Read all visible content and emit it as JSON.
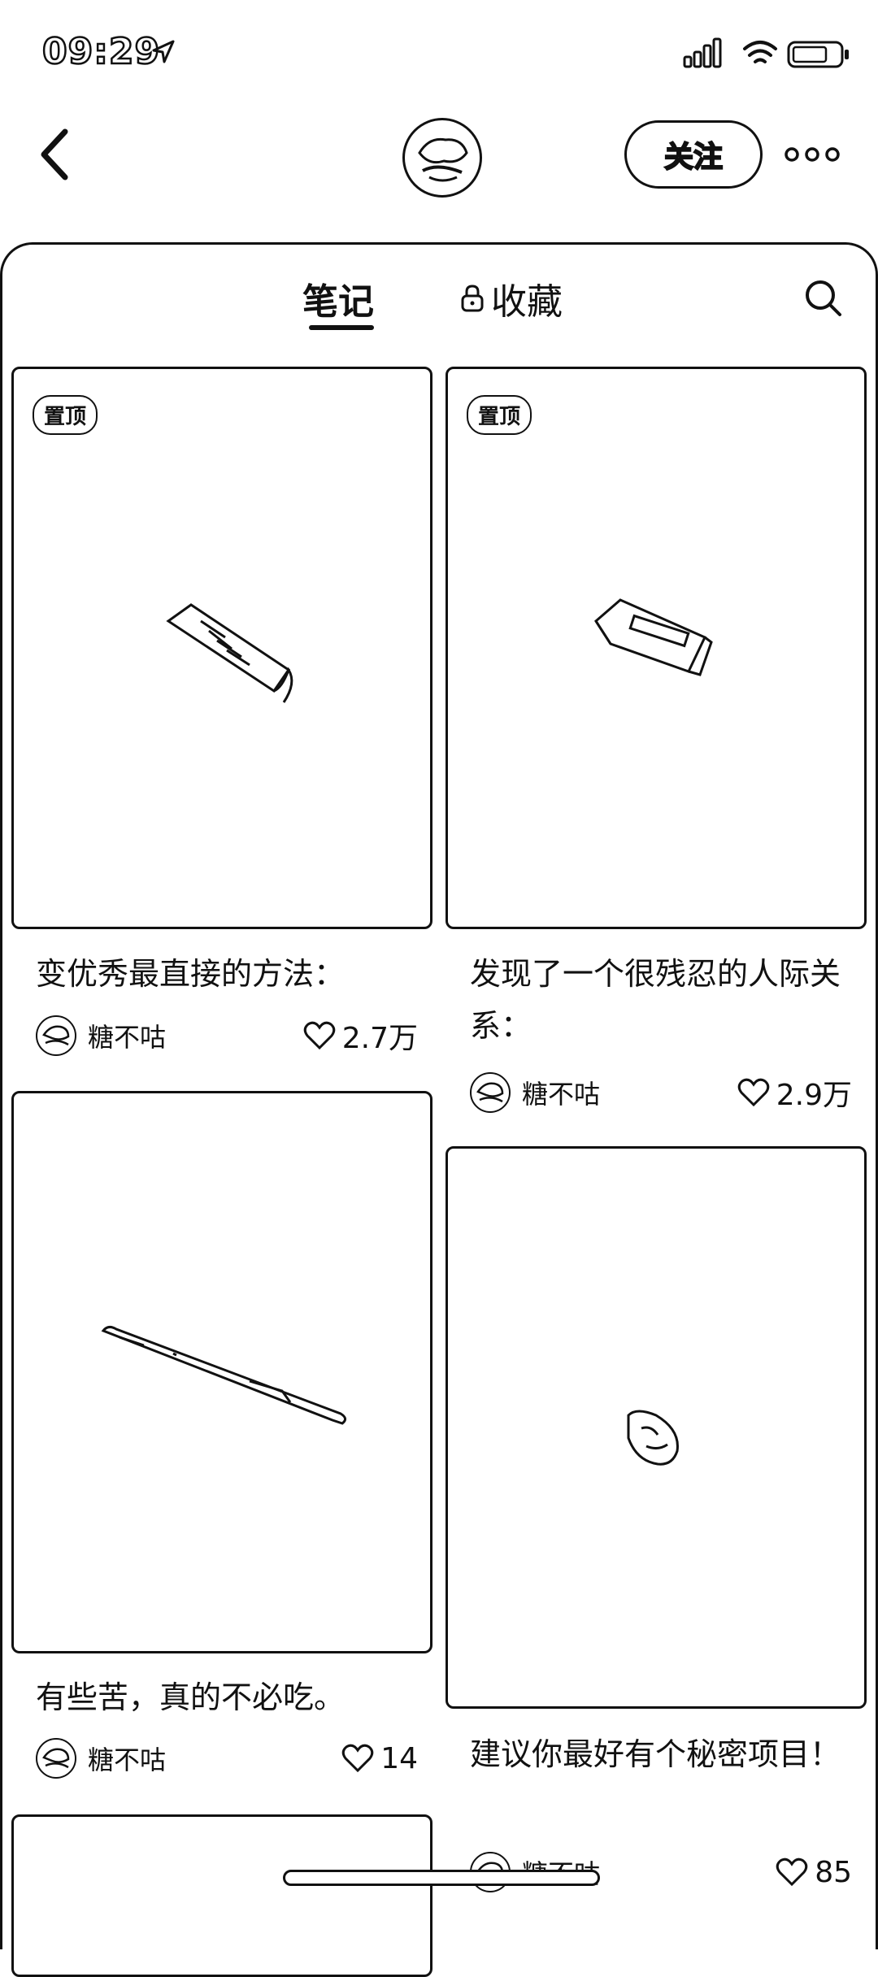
{
  "status_bar": {
    "time": "09:29"
  },
  "header": {
    "follow_label": "关注"
  },
  "tabs": {
    "notes": "笔记",
    "collect": "收藏"
  },
  "notes": [
    {
      "pin": "置顶",
      "title": "变优秀最直接的方法：",
      "author": "糖不咕",
      "likes": "2.7万"
    },
    {
      "pin": "置顶",
      "title": "发现了一个很残忍的人际关系：",
      "author": "糖不咕",
      "likes": "2.9万"
    },
    {
      "title": "有些苦，真的不必吃。",
      "author": "糖不咕",
      "likes": "14"
    },
    {
      "title": "建议你最好有个秘密项目！",
      "author": "糖不咕",
      "likes": "85"
    }
  ],
  "icons": [
    "location-arrow-icon",
    "signal-icon",
    "wifi-icon",
    "battery-icon",
    "back-chevron-icon",
    "more-dots-icon",
    "lock-icon",
    "search-icon",
    "heart-icon"
  ]
}
